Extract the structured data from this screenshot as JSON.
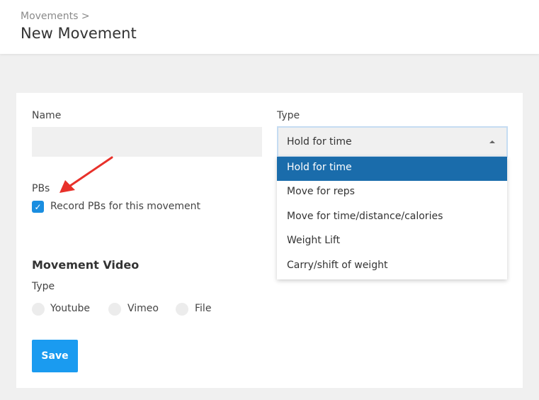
{
  "header": {
    "breadcrumb": "Movements >",
    "title": "New Movement"
  },
  "form": {
    "name_label": "Name",
    "name_value": "",
    "type_label": "Type",
    "type_selected": "Hold for time",
    "type_options": [
      "Hold for time",
      "Move for reps",
      "Move for time/distance/calories",
      "Weight Lift",
      "Carry/shift of weight"
    ],
    "pbs_label": "PBs",
    "pbs_checkbox_label": "Record PBs for this movement",
    "pbs_checked": true,
    "video_section_title": "Movement Video",
    "video_type_label": "Type",
    "video_types": [
      "Youtube",
      "Vimeo",
      "File"
    ],
    "save_label": "Save"
  },
  "colors": {
    "accent": "#1a9bf0",
    "selected_option": "#1a6cab",
    "annotation_arrow": "#e8312a"
  },
  "icons": {
    "checkbox": "check-icon",
    "select_caret": "caret-up-icon",
    "annotation": "arrow-icon"
  }
}
